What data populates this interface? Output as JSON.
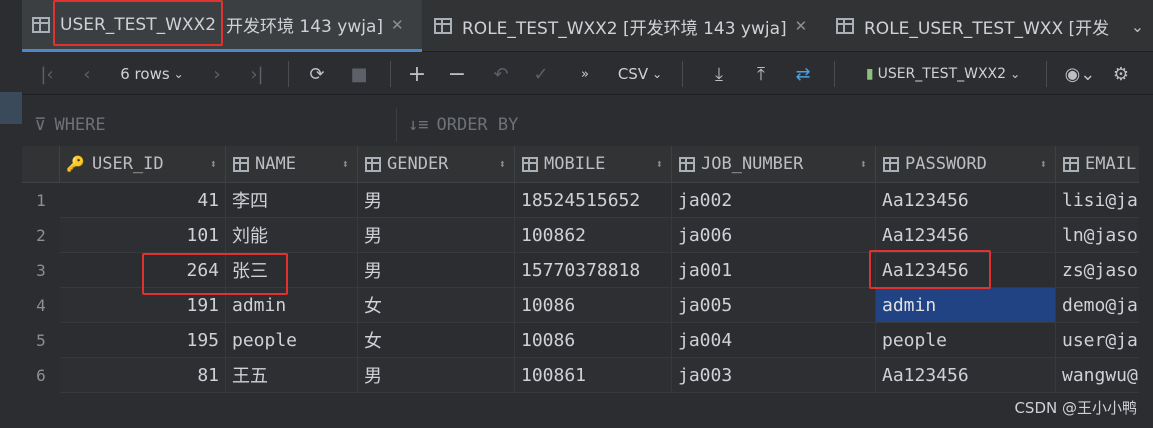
{
  "tabs": [
    {
      "label": "USER_TEST_WXX2",
      "suffix": "开发环境 143 ywja]",
      "active": true
    },
    {
      "label": "ROLE_TEST_WXX2 [开发环境 143 ywja]",
      "active": false
    },
    {
      "label": "ROLE_USER_TEST_WXX [开发",
      "active": false
    }
  ],
  "toolbar": {
    "rows_label": "6 rows",
    "export_format": "CSV",
    "datasource_label": "USER_TEST_WXX2"
  },
  "filter": {
    "where_label": "WHERE",
    "order_label": "ORDER BY"
  },
  "table": {
    "columns": [
      "USER_ID",
      "NAME",
      "GENDER",
      "MOBILE",
      "JOB_NUMBER",
      "PASSWORD",
      "EMAIL"
    ],
    "rows": [
      {
        "num": "1",
        "user_id": "41",
        "name": "李四",
        "gender": "男",
        "mobile": "18524515652",
        "job_number": "ja002",
        "password": "Aa123456",
        "email": "lisi@ja"
      },
      {
        "num": "2",
        "user_id": "101",
        "name": "刘能",
        "gender": "男",
        "mobile": "100862",
        "job_number": "ja006",
        "password": "Aa123456",
        "email": "ln@jaso"
      },
      {
        "num": "3",
        "user_id": "264",
        "name": "张三",
        "gender": "男",
        "mobile": "15770378818",
        "job_number": "ja001",
        "password": "Aa123456",
        "email": "zs@jaso"
      },
      {
        "num": "4",
        "user_id": "191",
        "name": "admin",
        "gender": "女",
        "mobile": "10086",
        "job_number": "ja005",
        "password": "admin",
        "email": "demo@ja"
      },
      {
        "num": "5",
        "user_id": "195",
        "name": "people",
        "gender": "女",
        "mobile": "10086",
        "job_number": "ja004",
        "password": "people",
        "email": "user@ja"
      },
      {
        "num": "6",
        "user_id": "81",
        "name": "王五",
        "gender": "男",
        "mobile": "100861",
        "job_number": "ja003",
        "password": "Aa123456",
        "email": "wangwu@"
      }
    ]
  },
  "watermark": "CSDN @王小小鸭",
  "colors": {
    "accent": "#4a88c7",
    "selection": "#214283",
    "highlight_box": "#e0322e"
  }
}
